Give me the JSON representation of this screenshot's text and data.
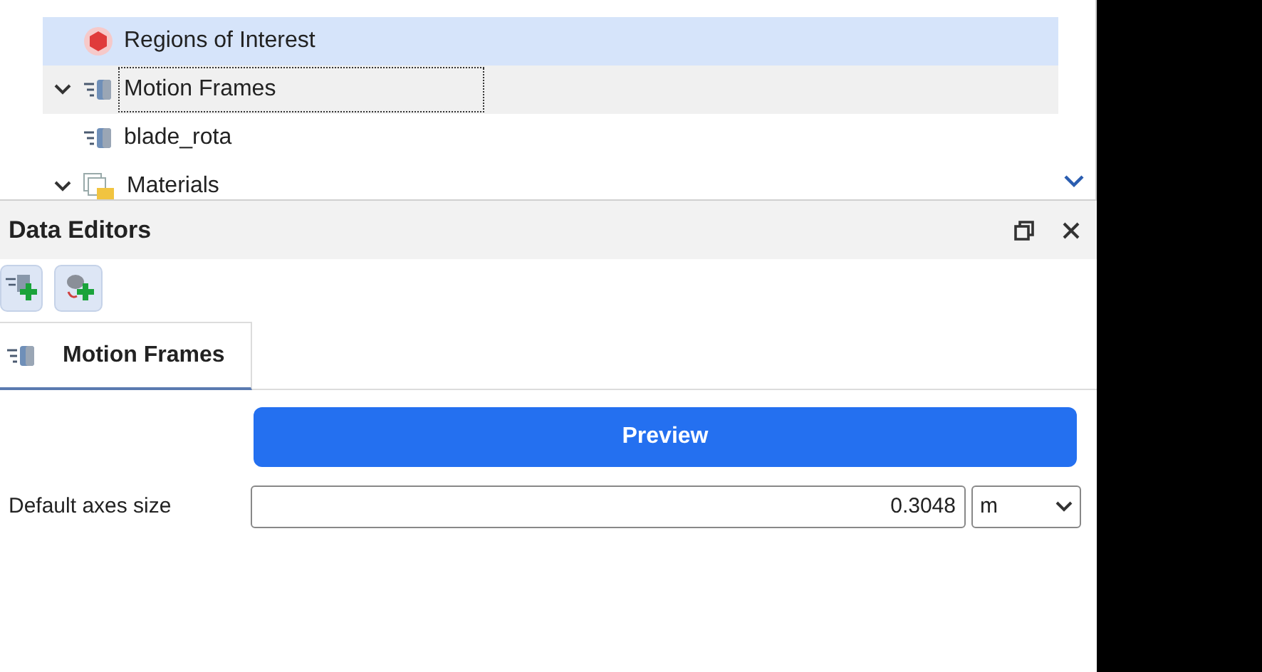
{
  "tree": {
    "items": [
      {
        "label": "Regions of Interest",
        "kind": "regions",
        "selected": true,
        "focused": false
      },
      {
        "label": "Motion Frames",
        "kind": "frames",
        "selected": false,
        "focused": true,
        "expanded": true,
        "children": [
          {
            "label": "blade_rota",
            "kind": "frames",
            "selected": false,
            "focused": false
          }
        ]
      },
      {
        "label": "Materials",
        "kind": "materials",
        "selected": false,
        "focused": false,
        "expanded": true
      }
    ]
  },
  "panel": {
    "title": "Data Editors",
    "tabs": [
      {
        "label": "Motion Frames",
        "selected": true
      }
    ],
    "preview_button": "Preview",
    "fields": [
      {
        "label": "Default axes size",
        "value": "0.3048",
        "unit": "m"
      }
    ]
  }
}
